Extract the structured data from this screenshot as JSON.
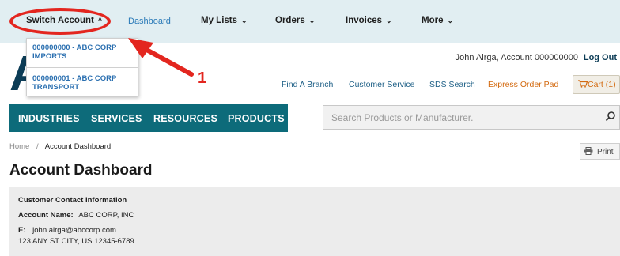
{
  "topnav": {
    "switch_account": "Switch Account",
    "dashboard": "Dashboard",
    "my_lists": "My Lists",
    "orders": "Orders",
    "invoices": "Invoices",
    "more": "More"
  },
  "switch_dropdown": {
    "items": [
      {
        "line1": "000000000 - ABC CORP",
        "line2": "IMPORTS"
      },
      {
        "line1": "000000001 - ABC CORP",
        "line2": "TRANSPORT"
      }
    ]
  },
  "annotation": {
    "number": "1",
    "color": "#e3261f"
  },
  "logo_fragment": "A",
  "account_bar": {
    "user_text": "John Airga, Account 000000000",
    "logout": "Log Out"
  },
  "utility_links": {
    "find_branch": "Find A Branch",
    "customer_service": "Customer Service",
    "sds_search": "SDS Search",
    "express_order_pad": "Express Order Pad",
    "cart": "Cart (1)"
  },
  "main_nav": {
    "items": [
      "INDUSTRIES",
      "SERVICES",
      "RESOURCES",
      "PRODUCTS"
    ],
    "color": "#0d6b7a"
  },
  "search": {
    "placeholder": "Search Products or Manufacturer."
  },
  "breadcrumb": {
    "home": "Home",
    "separator": "/",
    "current": "Account Dashboard"
  },
  "print_label": "Print",
  "page_title": "Account Dashboard",
  "contact": {
    "heading": "Customer Contact Information",
    "account_name_label": "Account Name:",
    "account_name": "ABC CORP, INC",
    "email_label": "E:",
    "email": "john.airga@abccorp.com",
    "address": "123 ANY ST CITY, US 12345-6789"
  }
}
